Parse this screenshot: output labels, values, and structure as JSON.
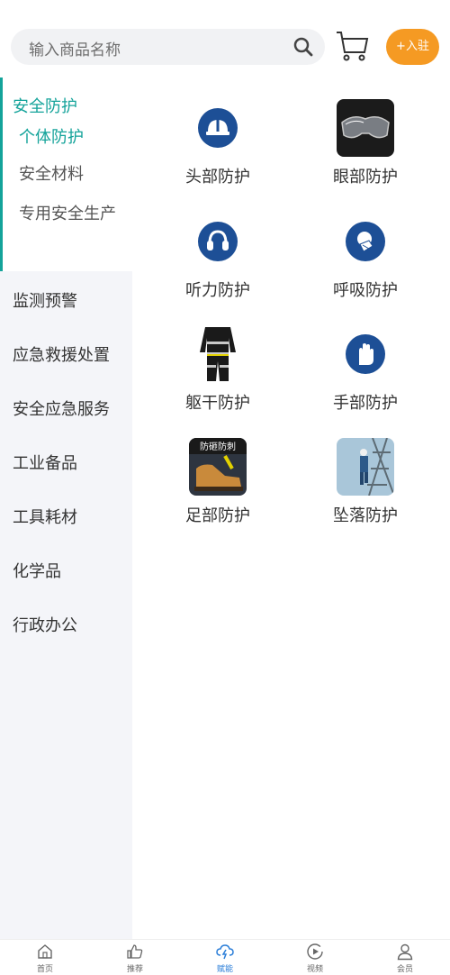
{
  "header": {
    "search_placeholder": "输入商品名称",
    "join_label": "+入驻"
  },
  "sidebar": {
    "active_category": "安全防护",
    "subcategories": [
      "个体防护",
      "安全材料",
      "专用安全生产"
    ],
    "items": [
      "监测预警",
      "应急救援处置",
      "安全应急服务",
      "工业备品",
      "工具耗材",
      "化学品",
      "行政办公"
    ]
  },
  "grid": [
    {
      "label": "头部防护",
      "icon": "helmet-icon"
    },
    {
      "label": "眼部防护",
      "icon": "goggles-photo"
    },
    {
      "label": "听力防护",
      "icon": "ear-protection-icon"
    },
    {
      "label": "呼吸防护",
      "icon": "respirator-icon"
    },
    {
      "label": "躯干防护",
      "icon": "suit-photo"
    },
    {
      "label": "手部防护",
      "icon": "glove-icon"
    },
    {
      "label": "足部防护",
      "icon": "boot-photo",
      "image_text": "防砸防刺"
    },
    {
      "label": "坠落防护",
      "icon": "climber-photo"
    }
  ],
  "bottom_nav": [
    {
      "label": "首页",
      "icon": "home-icon"
    },
    {
      "label": "推荐",
      "icon": "thumbs-up-icon"
    },
    {
      "label": "赋能",
      "icon": "cloud-energy-icon",
      "active": true
    },
    {
      "label": "视频",
      "icon": "play-icon"
    },
    {
      "label": "会员",
      "icon": "user-icon"
    }
  ],
  "colors": {
    "accent": "#14a39a",
    "join_button": "#f59a23",
    "icon_blue": "#1d4f96",
    "nav_active": "#2b7ed8"
  }
}
